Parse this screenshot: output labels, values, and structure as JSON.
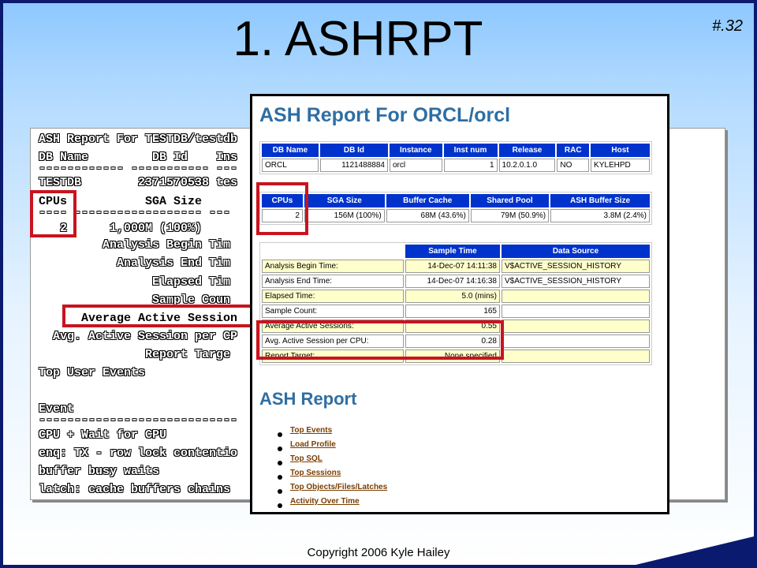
{
  "slide": {
    "title": "1. ASHRPT",
    "slide_tag": "#.32",
    "footer": "Copyright 2006 Kyle Hailey",
    "page_number": "32"
  },
  "text_report": {
    "lines": [
      "ASH Report For TESTDB/testdb",
      "DB Name         DB Id    Ins",
      "------------ ----------- ---",
      "TESTDB        2371570538 tes",
      "CPUs           SGA Size",
      "---- ------------------ ---",
      "   2      1,000M (100%)",
      "         Analysis Begin Tim",
      "           Analysis End Tim",
      "                Elapsed Tim",
      "                Sample Coun",
      "      Average Active Session",
      "  Avg. Active Session per CP",
      "               Report Targe",
      "Top User Events",
      "",
      "Event",
      "----------------------------",
      "CPU + Wait for CPU",
      "enq: TX - row lock contentio",
      "buffer busy waits",
      "latch: cache buffers chains"
    ]
  },
  "html_report": {
    "title": "ASH Report For ORCL/orcl",
    "db_table": {
      "headers": [
        "DB Name",
        "DB Id",
        "Instance",
        "Inst num",
        "Release",
        "RAC",
        "Host"
      ],
      "row": [
        "ORCL",
        "1121488884",
        "orcl",
        "1",
        "10.2.0.1.0",
        "NO",
        "KYLEHPD"
      ]
    },
    "sga_table": {
      "headers": [
        "CPUs",
        "SGA Size",
        "Buffer Cache",
        "Shared Pool",
        "ASH Buffer Size"
      ],
      "row": [
        "2",
        "156M (100%)",
        "68M (43.6%)",
        "79M (50.9%)",
        "3.8M (2.4%)"
      ]
    },
    "sample_table": {
      "headers": [
        "",
        "Sample Time",
        "Data Source"
      ],
      "rows": [
        [
          "Analysis Begin Time:",
          "14-Dec-07 14:11:38",
          "V$ACTIVE_SESSION_HISTORY"
        ],
        [
          "Analysis End Time:",
          "14-Dec-07 14:16:38",
          "V$ACTIVE_SESSION_HISTORY"
        ],
        [
          "Elapsed Time:",
          "5.0 (mins)",
          ""
        ],
        [
          "Sample Count:",
          "165",
          ""
        ],
        [
          "Average Active Sessions:",
          "0.55",
          ""
        ],
        [
          "Avg. Active Session per CPU:",
          "0.28",
          ""
        ],
        [
          "Report Target:",
          "None specified",
          ""
        ]
      ]
    },
    "section_title": "ASH Report",
    "links": [
      "Top Events",
      "Load Profile",
      "Top SQL",
      "Top Sessions",
      "Top Objects/Files/Latches",
      "Activity Over Time"
    ]
  },
  "colors": {
    "highlight_box": "#c8141e",
    "table_header": "#0033cc",
    "report_title": "#2f6ea3"
  }
}
